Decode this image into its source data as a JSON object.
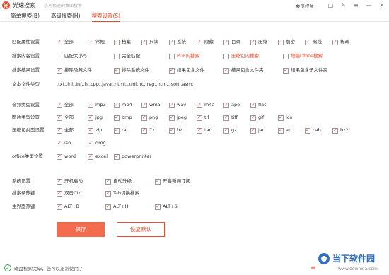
{
  "titlebar": {
    "logo_glyph": "光",
    "app_name": "光速搜索",
    "slogan": "小巧极速的桌面搜索",
    "vip_label": "会员权益",
    "icons": [
      "skin-icon",
      "feedback-icon",
      "menu-icon",
      "minimize-icon",
      "close-icon"
    ]
  },
  "menu": [
    {
      "label": "简单搜索(B)",
      "active": false
    },
    {
      "label": "高级搜索(H)",
      "active": false
    },
    {
      "label": "搜索设置(S)",
      "active": true
    }
  ],
  "rows": [
    {
      "key": "attr",
      "label": "匹配属性设置",
      "items": [
        {
          "label": "全部",
          "checked": true
        },
        {
          "label": "常规",
          "checked": true
        },
        {
          "label": "档案",
          "checked": true
        },
        {
          "label": "只读",
          "checked": true
        },
        {
          "label": "系统",
          "checked": true
        },
        {
          "label": "隐藏",
          "checked": true
        },
        {
          "label": "目录",
          "checked": true
        },
        {
          "label": "压缩",
          "checked": true
        },
        {
          "label": "加密",
          "checked": true
        },
        {
          "label": "离线",
          "checked": true
        },
        {
          "label": "稀疏",
          "checked": true
        }
      ]
    },
    {
      "key": "content",
      "label": "搜索内容设置",
      "items": [
        {
          "label": "匹配大小写",
          "checked": false
        },
        {
          "label": "完全匹配",
          "checked": false
        },
        {
          "label": "PDF内搜索",
          "checked": false,
          "red": true
        },
        {
          "label": "压缩包内搜索",
          "checked": false,
          "red": true
        },
        {
          "label": "增强Office搜索",
          "checked": false,
          "red": true
        }
      ]
    },
    {
      "key": "result",
      "label": "搜索结果设置",
      "items": [
        {
          "label": "排除隐藏文件",
          "checked": true
        },
        {
          "label": "排除系统文件",
          "checked": true
        },
        {
          "label": "结果包含文件",
          "checked": true
        },
        {
          "label": "结果包含文件夹",
          "checked": true
        },
        {
          "label": "结果包含子文件夹",
          "checked": true
        }
      ]
    },
    {
      "key": "text",
      "label": "文本文件类型",
      "text": ".txt;.ini;.inf;.h;.cpp;.java;.html;.xml;.rc;.reg;.htm;.json;.asm;"
    },
    {
      "key": "audio",
      "label": "音频类型设置",
      "items": [
        {
          "label": "全部",
          "checked": true
        },
        {
          "label": "mp3",
          "checked": true
        },
        {
          "label": "mp4",
          "checked": true
        },
        {
          "label": "wma",
          "checked": true
        },
        {
          "label": "wav",
          "checked": true
        },
        {
          "label": "m4a",
          "checked": true
        },
        {
          "label": "ape",
          "checked": true
        },
        {
          "label": "flac",
          "checked": true
        }
      ]
    },
    {
      "key": "image",
      "label": "图片类型设置",
      "items": [
        {
          "label": "全部",
          "checked": true
        },
        {
          "label": "jpg",
          "checked": true
        },
        {
          "label": "bmp",
          "checked": true
        },
        {
          "label": "png",
          "checked": true
        },
        {
          "label": "jpeg",
          "checked": true
        },
        {
          "label": "tif",
          "checked": true
        },
        {
          "label": "tiff",
          "checked": true
        },
        {
          "label": "gif",
          "checked": true
        },
        {
          "label": "ico",
          "checked": true
        }
      ]
    },
    {
      "key": "archive",
      "label": "压缩包类型设置",
      "items": [
        {
          "label": "全部",
          "checked": true
        },
        {
          "label": "zip",
          "checked": true
        },
        {
          "label": "rar",
          "checked": true
        },
        {
          "label": "7z",
          "checked": true
        },
        {
          "label": "bz",
          "checked": true
        },
        {
          "label": "tar",
          "checked": true
        },
        {
          "label": "gz",
          "checked": true
        },
        {
          "label": "jar",
          "checked": true
        },
        {
          "label": "arc",
          "checked": true
        },
        {
          "label": "cab",
          "checked": true
        },
        {
          "label": "bz2",
          "checked": true
        }
      ]
    },
    {
      "key": "archive2",
      "label": "",
      "items": [
        {
          "label": "iso",
          "checked": true
        },
        {
          "label": "dmg",
          "checked": true
        }
      ]
    },
    {
      "key": "office",
      "label": "office类型设置",
      "items": [
        {
          "label": "word",
          "checked": true
        },
        {
          "label": "excel",
          "checked": true
        },
        {
          "label": "powerprinter",
          "checked": true
        }
      ]
    },
    {
      "key": "system",
      "label": "系统设置",
      "items": [
        {
          "label": "开机启动",
          "checked": true
        },
        {
          "label": "自动升级",
          "checked": true
        },
        {
          "label": "开启新闻订阅",
          "checked": true
        }
      ]
    },
    {
      "key": "hotkey",
      "label": "搜索条热键",
      "items": [
        {
          "label": "双击Ctrl",
          "checked": true
        },
        {
          "label": "Tab切换搜索",
          "checked": true
        }
      ]
    },
    {
      "key": "mainhotkey",
      "label": "主界面热键",
      "items": [
        {
          "label": "ALT+B",
          "checked": true
        },
        {
          "label": "ALT+H",
          "checked": true
        },
        {
          "label": "ALT+S",
          "checked": true
        }
      ]
    }
  ],
  "buttons": {
    "save": "保存",
    "reset": "恢复默认"
  },
  "status": {
    "text": "磁盘检索完毕，您可以正常使用了",
    "icon": "check-circle-icon"
  },
  "watermark": {
    "line1": "当下软件园",
    "line2": "www.downxia.com"
  },
  "colors": {
    "accent": "#e94b2c",
    "check_green": "#3aa24a"
  }
}
